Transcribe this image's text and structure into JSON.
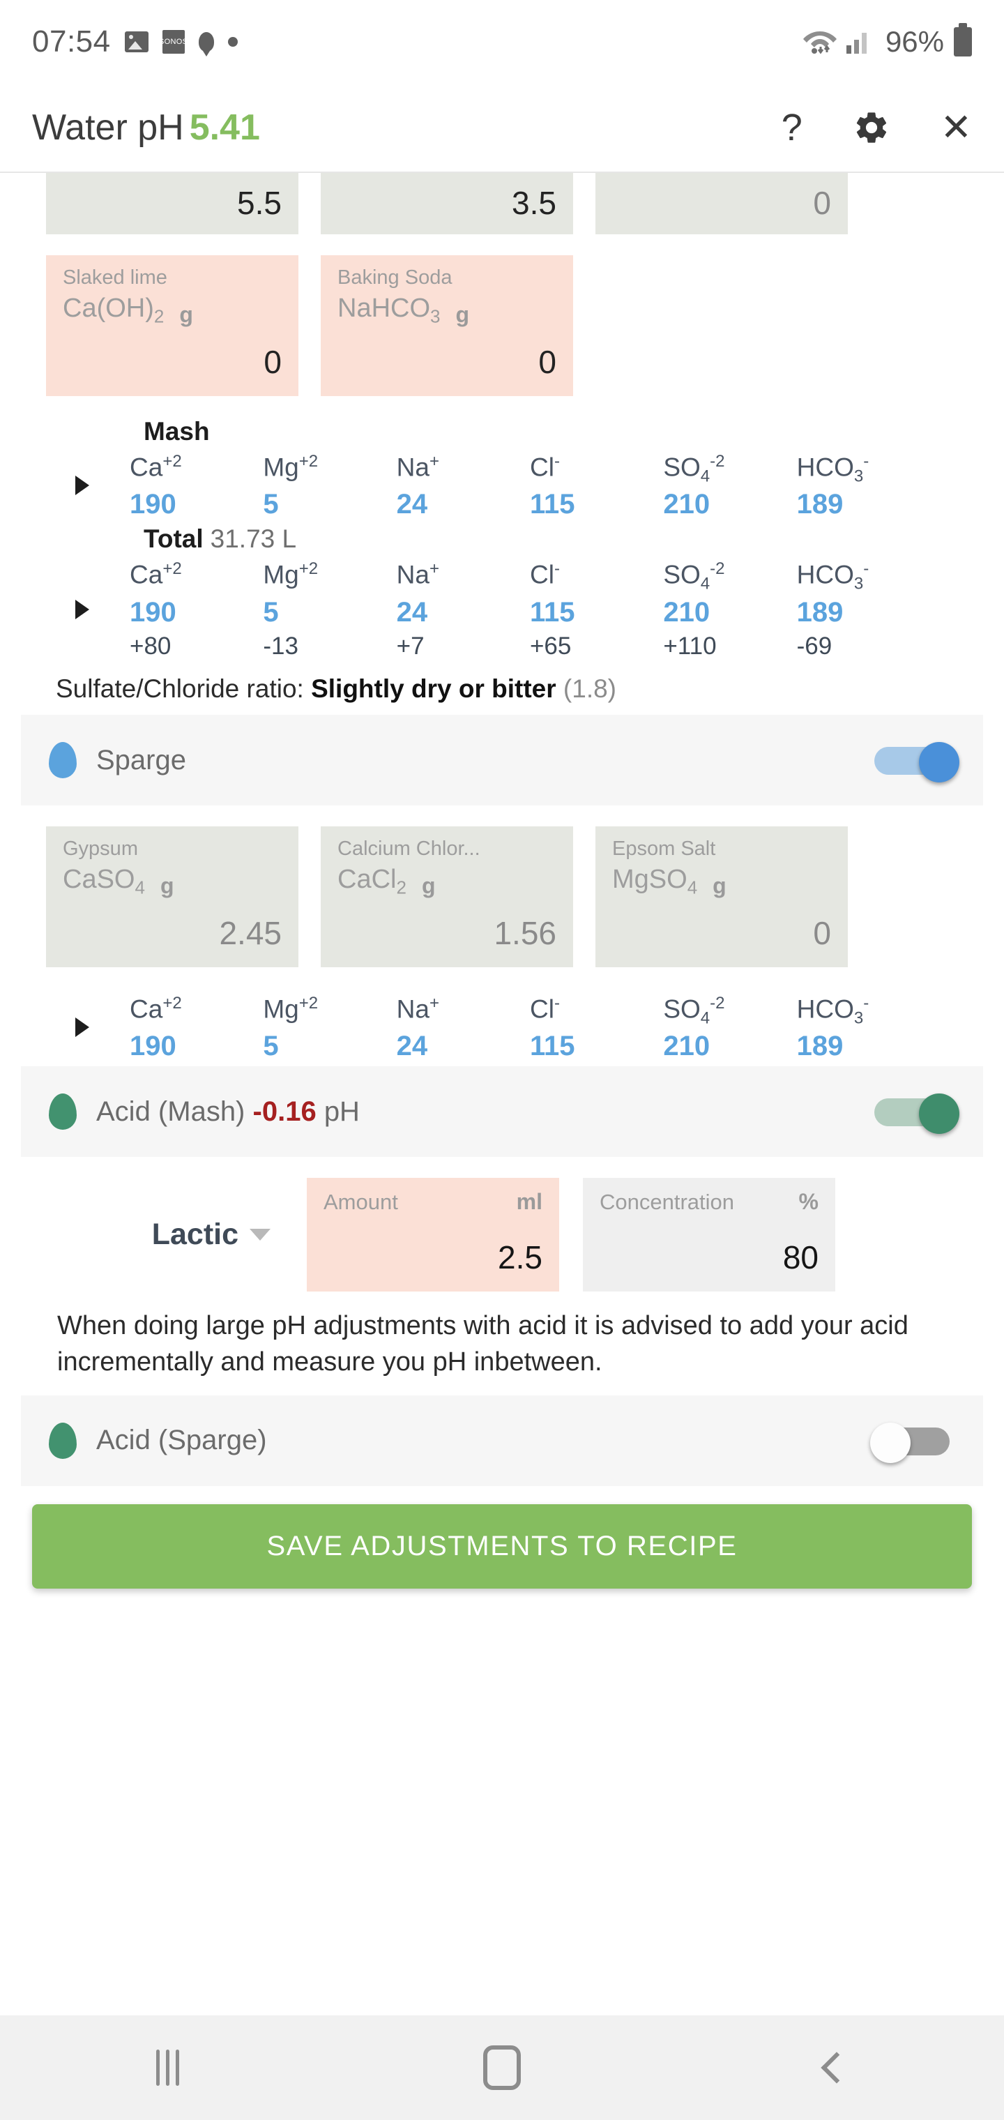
{
  "status_bar": {
    "time": "07:54",
    "icons": [
      "photo-icon",
      "sonos-icon",
      "bulb-icon",
      "dot-icon"
    ],
    "sonos_label": "SONOS",
    "battery_percent": "96%"
  },
  "header": {
    "title": "Water pH",
    "ph_value": "5.41",
    "ph_color": "#85bd5f",
    "help_icon": "?",
    "settings_icon": "gear-icon",
    "close_icon": "✕"
  },
  "cropped_top_row": [
    {
      "value": "5.5",
      "muted": false
    },
    {
      "value": "3.5",
      "muted": false
    },
    {
      "value": "0",
      "muted": true
    }
  ],
  "alkaline_boxes": [
    {
      "name": "Slaked lime",
      "formula_main": "Ca(OH)",
      "formula_sub": "2",
      "unit": "g",
      "value": "0"
    },
    {
      "name": "Baking Soda",
      "formula_main": "NaHCO",
      "formula_sub": "3",
      "unit": "g",
      "value": "0"
    }
  ],
  "mash": {
    "label": "Mash",
    "ions": [
      {
        "name": "Ca",
        "sub": "",
        "sup": "+2",
        "value": "190"
      },
      {
        "name": "Mg",
        "sub": "",
        "sup": "+2",
        "value": "5"
      },
      {
        "name": "Na",
        "sub": "",
        "sup": "+",
        "value": "24"
      },
      {
        "name": "Cl",
        "sub": "",
        "sup": "-",
        "value": "115"
      },
      {
        "name": "SO",
        "sub": "4",
        "sup": "-2",
        "value": "210"
      },
      {
        "name": "HCO",
        "sub": "3",
        "sup": "-",
        "value": "189"
      }
    ]
  },
  "total": {
    "label": "Total",
    "volume": "31.73 L",
    "ions": [
      {
        "name": "Ca",
        "sub": "",
        "sup": "+2",
        "value": "190",
        "delta": "+80"
      },
      {
        "name": "Mg",
        "sub": "",
        "sup": "+2",
        "value": "5",
        "delta": "-13"
      },
      {
        "name": "Na",
        "sub": "",
        "sup": "+",
        "value": "24",
        "delta": "+7"
      },
      {
        "name": "Cl",
        "sub": "",
        "sup": "-",
        "value": "115",
        "delta": "+65"
      },
      {
        "name": "SO",
        "sub": "4",
        "sup": "-2",
        "value": "210",
        "delta": "+110"
      },
      {
        "name": "HCO",
        "sub": "3",
        "sup": "-",
        "value": "189",
        "delta": "-69"
      }
    ]
  },
  "ratio": {
    "prefix": "Sulfate/Chloride ratio:",
    "verdict": "Slightly dry or bitter",
    "value": "(1.8)"
  },
  "sparge": {
    "label": "Sparge",
    "toggle_on": true,
    "salts": [
      {
        "name": "Gypsum",
        "formula_main": "CaSO",
        "formula_sub": "4",
        "unit": "g",
        "value": "2.45"
      },
      {
        "name": "Calcium Chlor...",
        "formula_main": "CaCl",
        "formula_sub": "2",
        "unit": "g",
        "value": "1.56"
      },
      {
        "name": "Epsom Salt",
        "formula_main": "MgSO",
        "formula_sub": "4",
        "unit": "g",
        "value": "0"
      }
    ],
    "ions": [
      {
        "name": "Ca",
        "sub": "",
        "sup": "+2",
        "value": "190"
      },
      {
        "name": "Mg",
        "sub": "",
        "sup": "+2",
        "value": "5"
      },
      {
        "name": "Na",
        "sub": "",
        "sup": "+",
        "value": "24"
      },
      {
        "name": "Cl",
        "sub": "",
        "sup": "-",
        "value": "115"
      },
      {
        "name": "SO",
        "sub": "4",
        "sup": "-2",
        "value": "210"
      },
      {
        "name": "HCO",
        "sub": "3",
        "sup": "-",
        "value": "189"
      }
    ]
  },
  "acid_mash": {
    "label": "Acid (Mash)",
    "delta_ph": "-0.16",
    "ph_suffix": "pH",
    "toggle_on": true,
    "acid_type": "Lactic",
    "amount": {
      "label": "Amount",
      "unit": "ml",
      "value": "2.5"
    },
    "concentration": {
      "label": "Concentration",
      "unit": "%",
      "value": "80"
    }
  },
  "advice_text": "When doing large pH adjustments with acid it is advised to add your acid incrementally and measure you pH inbetween.",
  "acid_sparge": {
    "label": "Acid (Sparge)",
    "toggle_on": false
  },
  "save_button": {
    "label": "SAVE ADJUSTMENTS TO RECIPE",
    "color": "#85bd5f"
  },
  "nav_bar": {
    "recents": "recents-icon",
    "home": "home-icon",
    "back": "back-icon"
  }
}
